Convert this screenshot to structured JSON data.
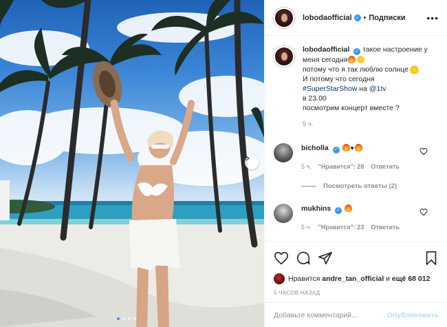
{
  "post": {
    "username": "lobodaofficial",
    "separator": "•",
    "follow_label": "Подписки",
    "more_label": "•••",
    "verified_mark": "✓"
  },
  "caption": {
    "username": "lobodaofficial",
    "line1": "такое настроение у меня сегодня",
    "line2": "потому что я так люблю солнце",
    "line3": "И потому что сегодня",
    "hashtag": "#SuperStarShow",
    "on_word": "на",
    "mention": "@1tv",
    "line5": "в 23.00",
    "line6": "посмотрим концерт вместе ?",
    "time": "5 ч."
  },
  "comments": [
    {
      "username": "bicholla",
      "time": "5 ч.",
      "likes_text": "\"Нравится\": 28",
      "reply_label": "Ответить",
      "view_replies": "Посмотреть ответы (2)"
    },
    {
      "username": "mukhins",
      "time": "5 ч.",
      "likes_text": "\"Нравится\": 23",
      "reply_label": "Ответить"
    }
  ],
  "likes": {
    "prefix": "Нравится",
    "user": "andre_tan_official",
    "middle": "и",
    "count_text": "ещё 68 012"
  },
  "time_ago": "5 часов назад",
  "add_comment": {
    "placeholder": "Добавьте комментарий...",
    "post_label": "Опубликовать"
  },
  "carousel": {
    "slides": 4,
    "active": 1
  },
  "colors": {
    "accent_blue": "#3897f0",
    "link": "#00376b",
    "muted": "#8e8e8e",
    "post_disabled": "#b2dffc"
  }
}
